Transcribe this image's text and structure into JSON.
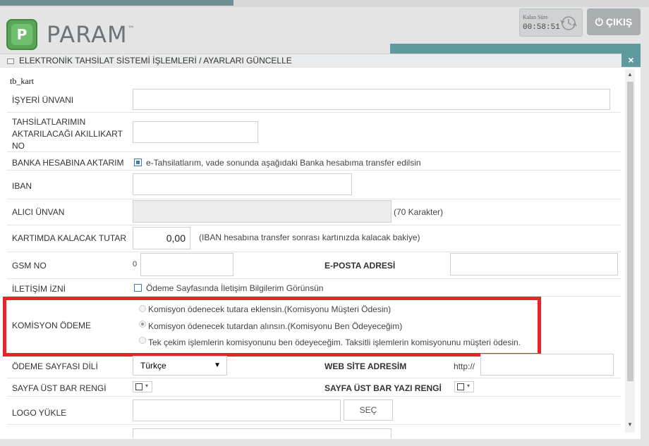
{
  "header": {
    "brand": "PARAM",
    "brand_tm": "™",
    "logo_letter": "P",
    "timer_label": "Kalan Süre",
    "timer_value": "00:58:51",
    "logout_label": "ÇIKIŞ"
  },
  "dialog": {
    "title": "ELEKTRONİK TAHSİLAT SİSTEMİ İŞLEMLERİ / AYARLARI GÜNCELLE",
    "close": "×"
  },
  "form": {
    "section": "tb_kart",
    "isyeri_unvani": {
      "label": "İŞYERİ ÜNVANI",
      "value": ""
    },
    "akillikart": {
      "label_line1": "TAHSİLATLARIMIN",
      "label_line2": "AKTARILACAĞI AKILLIKART",
      "label_line3": "NO",
      "value": ""
    },
    "banka_aktarim": {
      "label": "BANKA HESABINA AKTARIM",
      "checked": true,
      "text": "e-Tahsilatlarım, vade sonunda aşağıdaki Banka hesabıma transfer edilsin"
    },
    "iban": {
      "label": "IBAN",
      "value": ""
    },
    "alici_unvan": {
      "label": "ALICI ÜNVAN",
      "hint": "(70 Karakter)"
    },
    "kartimda_kalacak": {
      "label": "KARTIMDA KALACAK TUTAR",
      "value": "0,00",
      "hint": "(IBAN hesabına transfer sonrası kartınızda kalacak bakiye)"
    },
    "gsm": {
      "label": "GSM NO",
      "prefix": "0",
      "value": ""
    },
    "eposta": {
      "label": "E-POSTA ADRESİ",
      "value": ""
    },
    "iletisim_izni": {
      "label": "İLETİŞİM İZNİ",
      "checked": false,
      "text": "Ödeme Sayfasında İletişim Bilgilerim Görünsün"
    },
    "komisyon": {
      "label": "KOMİSYON ÖDEME",
      "options": [
        {
          "text": "Komisyon ödenecek tutara eklensin.(Komisyonu Müşteri Ödesin)",
          "selected": false
        },
        {
          "text": "Komisyon ödenecek tutardan alınsın.(Komisyonu Ben Ödeyeceğim)",
          "selected": true
        },
        {
          "text": "Tek çekim işlemlerin komisyonunu ben ödeyeceğim. Taksitli işlemlerin komisyonunu müşteri ödesin.",
          "selected": false
        }
      ]
    },
    "sayfa_dili": {
      "label": "ÖDEME SAYFASI DİLİ",
      "value": "Türkçe",
      "caret": "▼"
    },
    "web_site": {
      "label": "WEB SİTE ADRESİM",
      "prefix": "http://",
      "value": ""
    },
    "ust_bar_rengi": {
      "label": "SAYFA ÜST BAR RENGİ"
    },
    "ust_bar_yazi": {
      "label": "SAYFA ÜST BAR YAZI RENGİ"
    },
    "logo_yukle": {
      "label": "LOGO YÜKLE",
      "button": "SEÇ"
    }
  },
  "colors": {
    "accent": "#5f9a9e",
    "highlight": "#e8232a",
    "logo": "#5aa45a"
  }
}
